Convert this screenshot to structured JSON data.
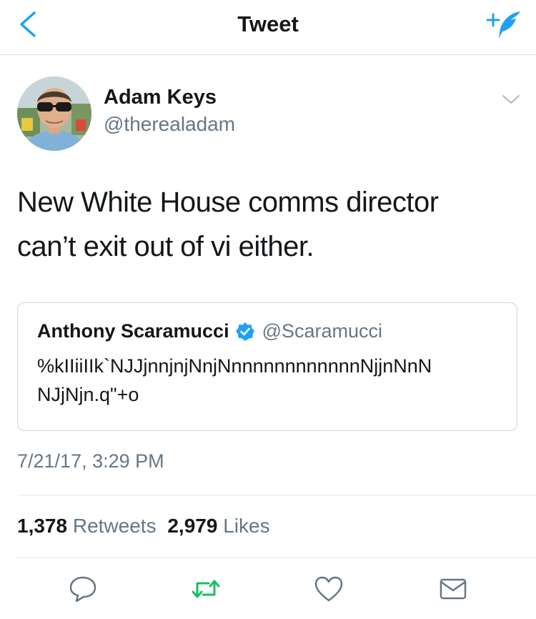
{
  "header": {
    "title": "Tweet",
    "back_icon": "chevron-left-icon",
    "compose_icon": "compose-feather-icon"
  },
  "tweet": {
    "author_name": "Adam Keys",
    "author_handle": "@therealadam",
    "text_line1": "New White House comms director",
    "text_line2": "can’t exit out of vi either.",
    "timestamp": "7/21/17, 3:29 PM",
    "stats": {
      "retweets_count": "1,378",
      "retweets_label": "Retweets",
      "likes_count": "2,979",
      "likes_label": "Likes"
    }
  },
  "quoted_tweet": {
    "author_name": "Anthony Scaramucci",
    "author_handle": "@Scaramucci",
    "verified": true,
    "text": "%kIIiiIIk`NJJjnnjnjNnjNnnnnnnnnnnnnNjjnNnN NJjNjn.q\"+o"
  },
  "actions": {
    "reply_icon": "reply-bubble-icon",
    "retweet_icon": "retweet-icon",
    "like_icon": "heart-icon",
    "message_icon": "envelope-icon"
  },
  "colors": {
    "accent": "#1da1f2",
    "retweet_green": "#17bf63",
    "text_primary": "#14171a",
    "text_secondary": "#657786",
    "divider": "#e1e8ed"
  }
}
